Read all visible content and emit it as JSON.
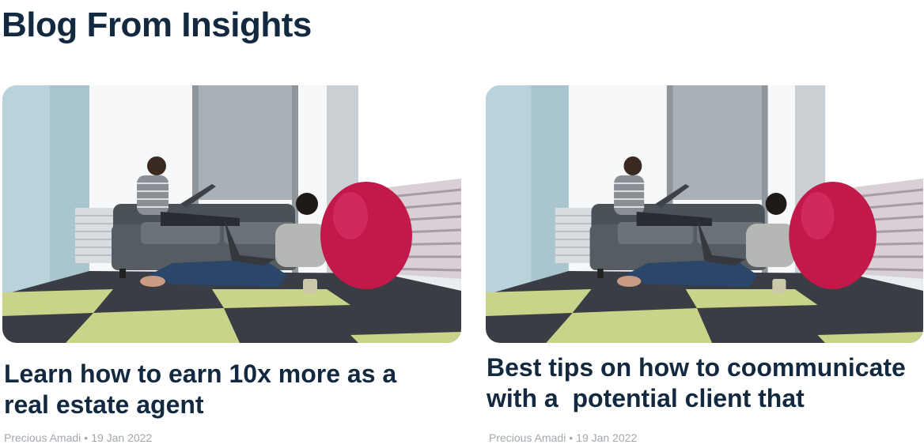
{
  "section": {
    "title": "Blog From Insights"
  },
  "posts": [
    {
      "title": "Learn how to earn 10x more as a real estate agent",
      "author": "Precious Amadi",
      "separator": "•",
      "date": "19 Jan 2022",
      "image_alt": "Two women working on laptops in an office lounge with a pink bean bag"
    },
    {
      "title": "Best tips on how to coommunicate with a  potential client that",
      "author": "Precious Amadi",
      "separator": "•",
      "date": "19 Jan 2022",
      "image_alt": "Two women working on laptops in an office lounge with a pink bean bag"
    }
  ],
  "colors": {
    "heading": "#12293f",
    "meta": "#a2a8ae",
    "beanbag": "#c2184a",
    "sofa": "#4a5257",
    "carpet_dark": "#3a3d44",
    "carpet_green": "#c9d48a"
  }
}
